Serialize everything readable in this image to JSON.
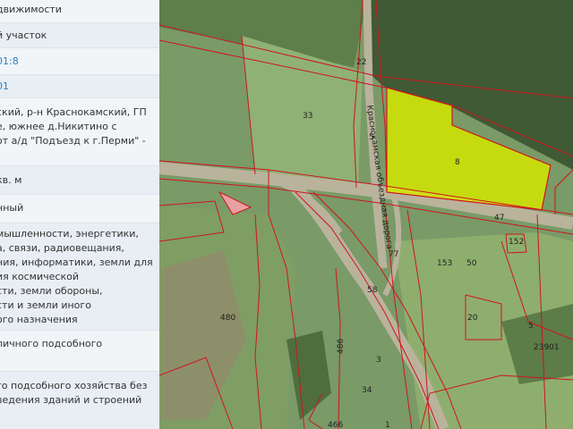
{
  "panel": {
    "rows": [
      {
        "lines": [
          "движимости"
        ]
      },
      {
        "lines": [
          "й участок"
        ]
      },
      {
        "lines": [
          "01:8"
        ],
        "link": true
      },
      {
        "lines": [
          "01"
        ],
        "link": true
      },
      {
        "lines": [
          "ский, р-н Краснокамский, ГП",
          "е, южнее д.Никитино с",
          "от а/д \"Подъезд к г.Перми\" -"
        ]
      },
      {
        "lines": [
          "кв. м"
        ]
      },
      {
        "lines": [
          "нный"
        ]
      },
      {
        "lines": [
          "мышленности, энергетики,",
          "а, связи, радиовещания,",
          "ния, информатики, земли для",
          "ия космической",
          "сти, земли обороны,",
          "сти и земли иного",
          "ого назначения"
        ]
      },
      {
        "lines": [
          "личного подсобного"
        ]
      },
      {
        "lines": [
          "го подсобного хозяйства без",
          "ведения зданий и строений"
        ]
      }
    ]
  },
  "map": {
    "road_label": "Краснокамская объездная дорога",
    "selected_parcel_label": "8",
    "parcel_labels": [
      "22",
      "33",
      "5",
      "47",
      "152",
      "77",
      "153",
      "50",
      "58",
      "480",
      "20",
      "5",
      "23901",
      "486",
      "3",
      "34",
      "466",
      "1"
    ],
    "colors": {
      "selected_fill": "#d4e600",
      "boundary": "#d0141e",
      "road": "#b9b39c"
    }
  }
}
